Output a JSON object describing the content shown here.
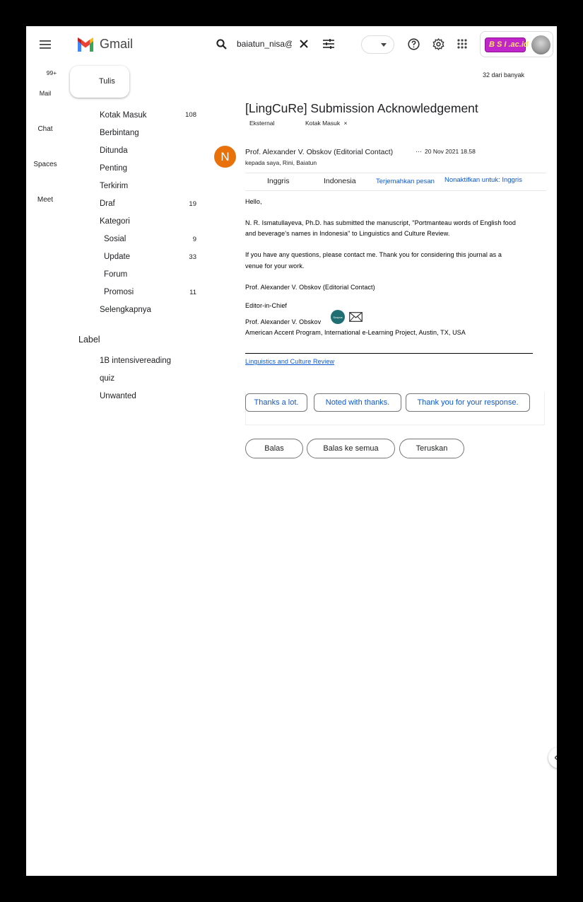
{
  "header": {
    "app_name": "Gmail",
    "search_value": "baiatun_nisa@",
    "brand_colors": {
      "red": "#ea4335",
      "blue": "#4285f4",
      "yellow": "#fbbc04",
      "green": "#34a853"
    }
  },
  "rail": {
    "badge": "99+",
    "items": [
      {
        "label": "Mail"
      },
      {
        "label": "Chat"
      },
      {
        "label": "Spaces"
      },
      {
        "label": "Meet"
      }
    ]
  },
  "sidebar": {
    "compose_label": "Tulis",
    "items": [
      {
        "label": "Kotak Masuk",
        "count": "108"
      },
      {
        "label": "Berbintang",
        "count": ""
      },
      {
        "label": "Ditunda",
        "count": ""
      },
      {
        "label": "Penting",
        "count": ""
      },
      {
        "label": "Terkirim",
        "count": ""
      },
      {
        "label": "Draf",
        "count": "19"
      },
      {
        "label": "Kategori",
        "count": ""
      }
    ],
    "categories": [
      {
        "label": "Sosial",
        "count": "9"
      },
      {
        "label": "Update",
        "count": "33"
      },
      {
        "label": "Forum",
        "count": ""
      },
      {
        "label": "Promosi",
        "count": "11"
      }
    ],
    "more_label": "Selengkapnya",
    "labels_heading": "Label",
    "labels": [
      {
        "label": "1B intensivereading"
      },
      {
        "label": "quiz"
      },
      {
        "label": "Unwanted"
      }
    ]
  },
  "message": {
    "pagination": "32 dari banyak",
    "subject": "[LingCuRe] Submission Acknowledgement",
    "tags": {
      "external": "Eksternal",
      "inbox": "Kotak Masuk"
    },
    "avatar_letter": "N",
    "avatar_color": "#e8710a",
    "sender": "Prof. Alexander V. Obskov (Editorial Contact)",
    "date": "20 Nov 2021 18.58",
    "recipients": "kepada saya, Rini, Baiatun",
    "translate": {
      "from": "Inggris",
      "to": "Indonesia",
      "translate_link": "Terjemahkan pesan",
      "disable_link": "Nonaktifkan untuk: Inggris"
    },
    "body": {
      "greeting": "Hello,",
      "p1_line1": "N. R. Ismatullayeva, Ph.D. has submitted the manuscript, \"Portmanteau words of English food",
      "p1_line2": "and beverage's names in Indonesia\" to Linguistics and Culture Review.",
      "p2_line1": "If you have any questions, please contact me. Thank you for considering this journal as a",
      "p2_line2": "venue for your work.",
      "sign1": "Prof. Alexander V. Obskov (Editorial Contact)",
      "role": "Editor-in-Chief",
      "sign2": "Prof. Alexander V. Obskov",
      "scopus_label": "Scopus",
      "address": "American Accent Program, International e-Learning Project, Austin, TX, USA",
      "journal_link": "Linguistics and Culture Review"
    },
    "smart_replies": [
      "Thanks a lot.",
      "Noted with thanks.",
      "Thank you for your response."
    ],
    "actions": {
      "reply": "Balas",
      "reply_all": "Balas ke semua",
      "forward": "Teruskan"
    }
  },
  "account_badge": {
    "text": "B S I .ac.id"
  }
}
